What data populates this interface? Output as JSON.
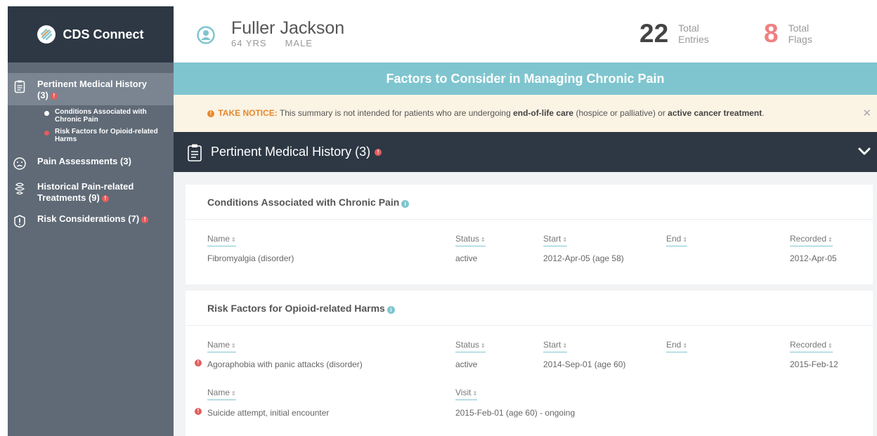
{
  "brand": {
    "name": "CDS Connect"
  },
  "sidebar": {
    "items": [
      {
        "label": "Pertinent Medical History",
        "count": "(3)"
      },
      {
        "label": "Pain Assessments (3)"
      },
      {
        "label": "Historical Pain-related Treatments (9)"
      },
      {
        "label": "Risk Considerations (7)"
      }
    ],
    "subitems": [
      {
        "label": "Conditions Associated with Chronic Pain"
      },
      {
        "label": "Risk Factors for Opioid-related Harms"
      }
    ]
  },
  "patient": {
    "name": "Fuller Jackson",
    "age": "64 YRS",
    "gender": "MALE"
  },
  "stats": {
    "entries": {
      "value": "22",
      "label_1": "Total",
      "label_2": "Entries"
    },
    "flags": {
      "value": "8",
      "label_1": "Total",
      "label_2": "Flags"
    }
  },
  "summary_title": "Factors to Consider in Managing Chronic Pain",
  "notice": {
    "prefix": "TAKE NOTICE:",
    "text_1": " This summary is not intended for patients who are undergoing ",
    "bold_1": "end-of-life care",
    "text_2": " (hospice or palliative) or ",
    "bold_2": "active cancer treatment",
    "text_3": ".",
    "close": "✕"
  },
  "section": {
    "title": "Pertinent Medical History (3)"
  },
  "conditions": {
    "title": "Conditions Associated with Chronic Pain",
    "headers": {
      "name": "Name",
      "status": "Status",
      "start": "Start",
      "end": "End",
      "recorded": "Recorded"
    },
    "rows": [
      {
        "name": "Fibromyalgia (disorder)",
        "status": "active",
        "start": "2012-Apr-05 (age 58)",
        "end": "",
        "recorded": "2012-Apr-05"
      }
    ]
  },
  "risk_factors": {
    "title": "Risk Factors for Opioid-related Harms",
    "headers": {
      "name": "Name",
      "status": "Status",
      "start": "Start",
      "end": "End",
      "recorded": "Recorded"
    },
    "rows": [
      {
        "name": "Agoraphobia with panic attacks (disorder)",
        "status": "active",
        "start": "2014-Sep-01 (age 60)",
        "end": "",
        "recorded": "2015-Feb-12"
      }
    ],
    "headers_2": {
      "name": "Name",
      "visit": "Visit"
    },
    "rows_2": [
      {
        "name": "Suicide attempt, initial encounter",
        "visit": "2015-Feb-01 (age 60) - ongoing"
      }
    ]
  },
  "sort_glyph": "⇕",
  "flag_glyph": "!",
  "info_glyph": "i",
  "colors": {
    "accent": "#7fc5cf",
    "sidebar": "#5f6a76",
    "dark": "#2d3844",
    "flag": "#e25d5d",
    "notice": "#e6882d"
  }
}
